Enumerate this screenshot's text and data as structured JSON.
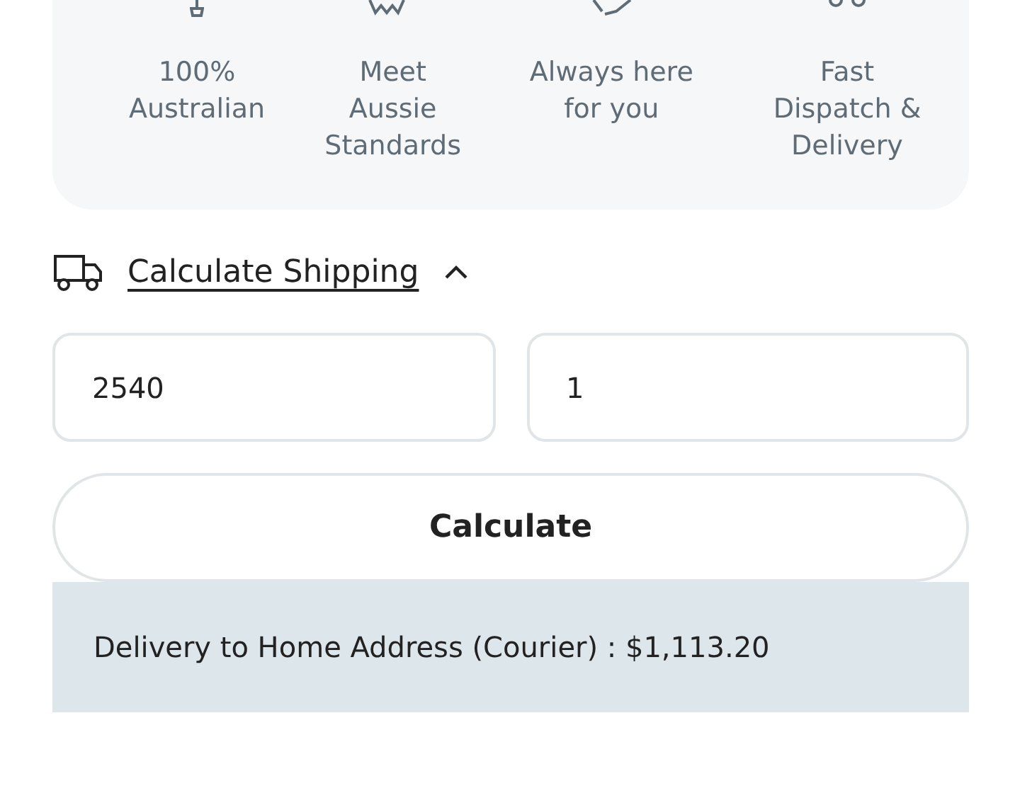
{
  "features": [
    {
      "label": "100%\nAustralian"
    },
    {
      "label": "Meet\nAussie\nStandards"
    },
    {
      "label": "Always here\nfor you"
    },
    {
      "label": "Fast\nDispatch &\nDelivery"
    }
  ],
  "shipping": {
    "title": "Calculate Shipping",
    "expanded": true,
    "fields": [
      {
        "value": "2540"
      },
      {
        "value": "1"
      }
    ],
    "button": "Calculate",
    "result": "Delivery to Home Address (Courier) : $1,113.20"
  }
}
